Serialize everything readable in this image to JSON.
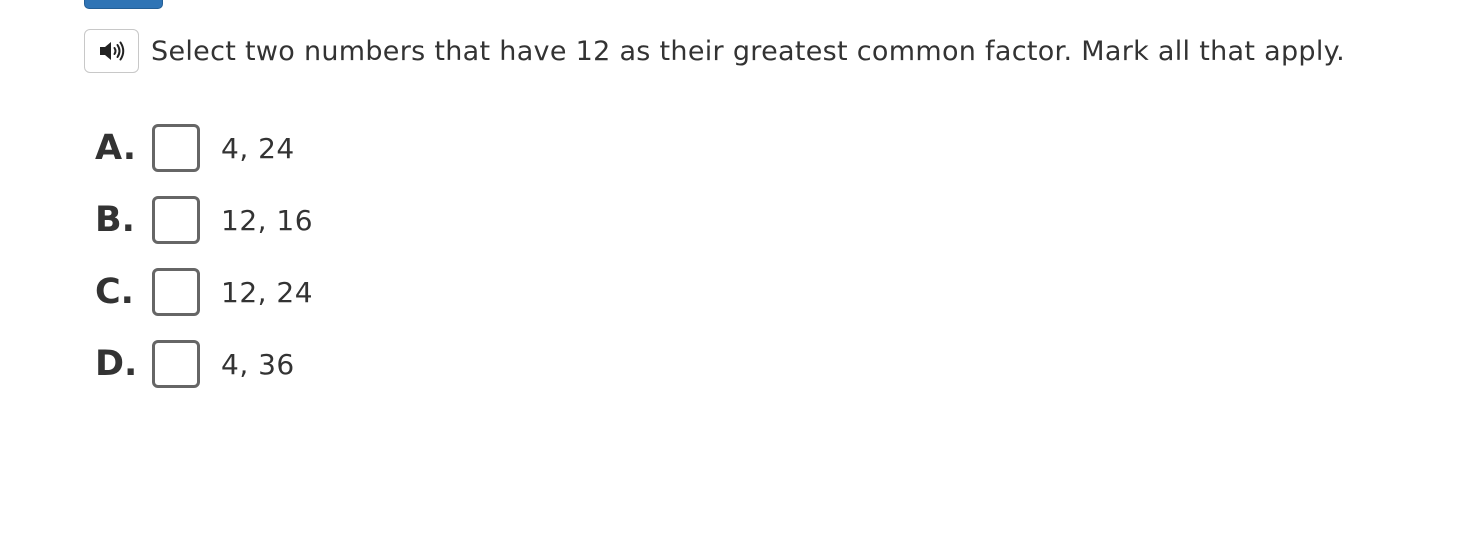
{
  "question": {
    "audio_icon": "speaker-icon",
    "text": "Select two numbers that have 12 as their greatest common factor. Mark all that apply."
  },
  "options": [
    {
      "letter": "A.",
      "text": "4, 24",
      "checked": false
    },
    {
      "letter": "B.",
      "text": "12, 16",
      "checked": false
    },
    {
      "letter": "C.",
      "text": "12, 24",
      "checked": false
    },
    {
      "letter": "D.",
      "text": "4, 36",
      "checked": false
    }
  ],
  "colors": {
    "top_tab": "#2f74b5",
    "checkbox_border": "#666666",
    "text": "#333333"
  }
}
